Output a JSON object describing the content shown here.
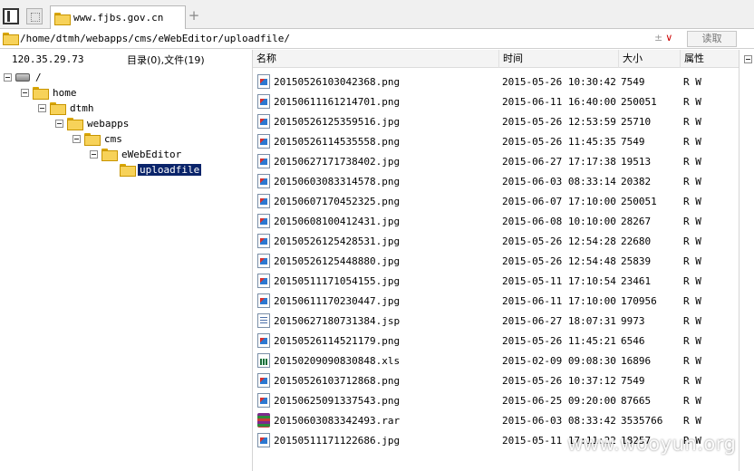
{
  "browser": {
    "tab_title": "www.fjbs.gov.cn",
    "new_tab_label": "+"
  },
  "address_bar": {
    "path": "/home/dtmh/webapps/cms/eWebEditor/uploadfile/",
    "tools_label": "±",
    "chevron_label": "∨",
    "read_button_label": "读取"
  },
  "tree": {
    "host_ip": "120.35.29.73",
    "summary": "目录(0),文件(19)",
    "nodes": [
      {
        "label": "/"
      },
      {
        "label": "home"
      },
      {
        "label": "dtmh"
      },
      {
        "label": "webapps"
      },
      {
        "label": "cms"
      },
      {
        "label": "eWebEditor"
      },
      {
        "label": "uploadfile",
        "selected": true
      }
    ]
  },
  "file_list": {
    "columns": [
      "名称",
      "时间",
      "大小",
      "属性"
    ],
    "files": [
      {
        "name": "20150526103042368.png",
        "time": "2015-05-26 10:30:42",
        "size": "7549",
        "attr": "R W",
        "type": "png"
      },
      {
        "name": "20150611161214701.png",
        "time": "2015-06-11 16:40:00",
        "size": "250051",
        "attr": "R W",
        "type": "png"
      },
      {
        "name": "20150526125359516.jpg",
        "time": "2015-05-26 12:53:59",
        "size": "25710",
        "attr": "R W",
        "type": "jpg"
      },
      {
        "name": "20150526114535558.png",
        "time": "2015-05-26 11:45:35",
        "size": "7549",
        "attr": "R W",
        "type": "png"
      },
      {
        "name": "20150627171738402.jpg",
        "time": "2015-06-27 17:17:38",
        "size": "19513",
        "attr": "R W",
        "type": "jpg"
      },
      {
        "name": "20150603083314578.png",
        "time": "2015-06-03 08:33:14",
        "size": "20382",
        "attr": "R W",
        "type": "png"
      },
      {
        "name": "20150607170452325.png",
        "time": "2015-06-07 17:10:00",
        "size": "250051",
        "attr": "R W",
        "type": "png"
      },
      {
        "name": "20150608100412431.jpg",
        "time": "2015-06-08 10:10:00",
        "size": "28267",
        "attr": "R W",
        "type": "jpg"
      },
      {
        "name": "20150526125428531.jpg",
        "time": "2015-05-26 12:54:28",
        "size": "22680",
        "attr": "R W",
        "type": "jpg"
      },
      {
        "name": "20150526125448880.jpg",
        "time": "2015-05-26 12:54:48",
        "size": "25839",
        "attr": "R W",
        "type": "jpg"
      },
      {
        "name": "20150511171054155.jpg",
        "time": "2015-05-11 17:10:54",
        "size": "23461",
        "attr": "R W",
        "type": "jpg"
      },
      {
        "name": "20150611170230447.jpg",
        "time": "2015-06-11 17:10:00",
        "size": "170956",
        "attr": "R W",
        "type": "jpg"
      },
      {
        "name": "20150627180731384.jsp",
        "time": "2015-06-27 18:07:31",
        "size": "9973",
        "attr": "R W",
        "type": "jsp"
      },
      {
        "name": "20150526114521179.png",
        "time": "2015-05-26 11:45:21",
        "size": "6546",
        "attr": "R W",
        "type": "png"
      },
      {
        "name": "20150209090830848.xls",
        "time": "2015-02-09 09:08:30",
        "size": "16896",
        "attr": "R W",
        "type": "xls"
      },
      {
        "name": "20150526103712868.png",
        "time": "2015-05-26 10:37:12",
        "size": "7549",
        "attr": "R W",
        "type": "png"
      },
      {
        "name": "20150625091337543.png",
        "time": "2015-06-25 09:20:00",
        "size": "87665",
        "attr": "R W",
        "type": "png"
      },
      {
        "name": "20150603083342493.rar",
        "time": "2015-06-03 08:33:42",
        "size": "3535766",
        "attr": "R W",
        "type": "rar"
      },
      {
        "name": "20150511171122686.jpg",
        "time": "2015-05-11 17:11:22",
        "size": "18257",
        "attr": "R W",
        "type": "jpg"
      }
    ]
  },
  "watermark": "www.wooyun.org",
  "colors": {
    "selection": "#0a246a",
    "folder": "#f7d259"
  }
}
